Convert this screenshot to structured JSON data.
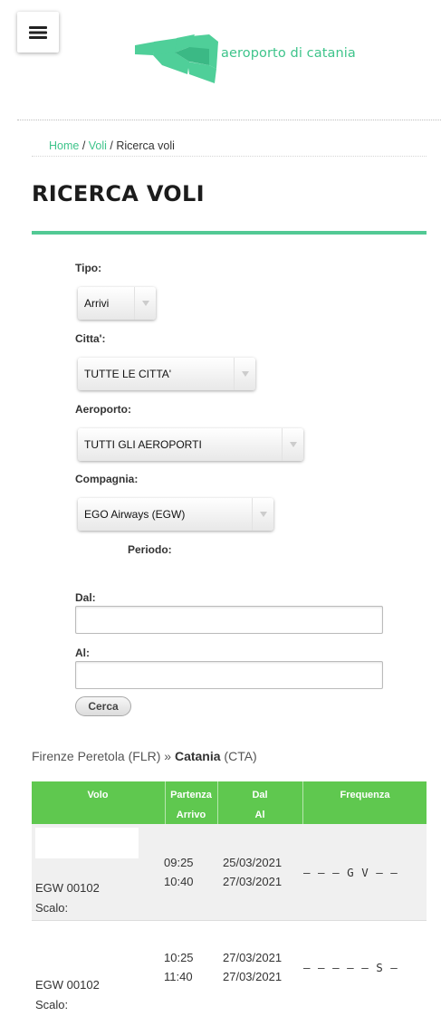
{
  "header": {
    "logo_text": "aeroporto di catania"
  },
  "breadcrumb": {
    "home": "Home",
    "sep1": " / ",
    "voli": "Voli",
    "sep2": " / ",
    "current": "Ricerca voli"
  },
  "page_title": "RICERCA VOLI",
  "form": {
    "tipo_label": "Tipo:",
    "tipo_value": "Arrivi",
    "citta_label": "Citta':",
    "citta_value": "TUTTE LE CITTA'",
    "aeroporto_label": "Aeroporto:",
    "aeroporto_value": "TUTTI GLI AEROPORTI",
    "compagnia_label": "Compagnia:",
    "compagnia_value": "EGO Airways (EGW)",
    "periodo_label": "Periodo:",
    "dal_label": "Dal:",
    "dal_value": "",
    "al_label": "Al:",
    "al_value": "",
    "cerca_label": "Cerca"
  },
  "route": {
    "origin": "Firenze Peretola (FLR) » ",
    "destination": "Catania",
    "destination_code": " (CTA)"
  },
  "table": {
    "headers": {
      "volo": "Volo",
      "partenza": "Partenza",
      "arrivo": "Arrivo",
      "dal": "Dal",
      "al": "Al",
      "frequenza": "Frequenza"
    },
    "rows": [
      {
        "flight": "EGW 00102",
        "scalo": "Scalo:",
        "departure": "09:25",
        "arrival": "10:40",
        "from": "25/03/2021",
        "to": "27/03/2021",
        "frequency": "– – – G V – –"
      },
      {
        "flight": "EGW 00102",
        "scalo": "Scalo:",
        "departure": "10:25",
        "arrival": "11:40",
        "from": "27/03/2021",
        "to": "27/03/2021",
        "frequency": "– – – – – S –"
      }
    ]
  },
  "colors": {
    "brand": "#3ec48b",
    "table_header": "#5fc84f",
    "title_underline": "#52c994"
  }
}
